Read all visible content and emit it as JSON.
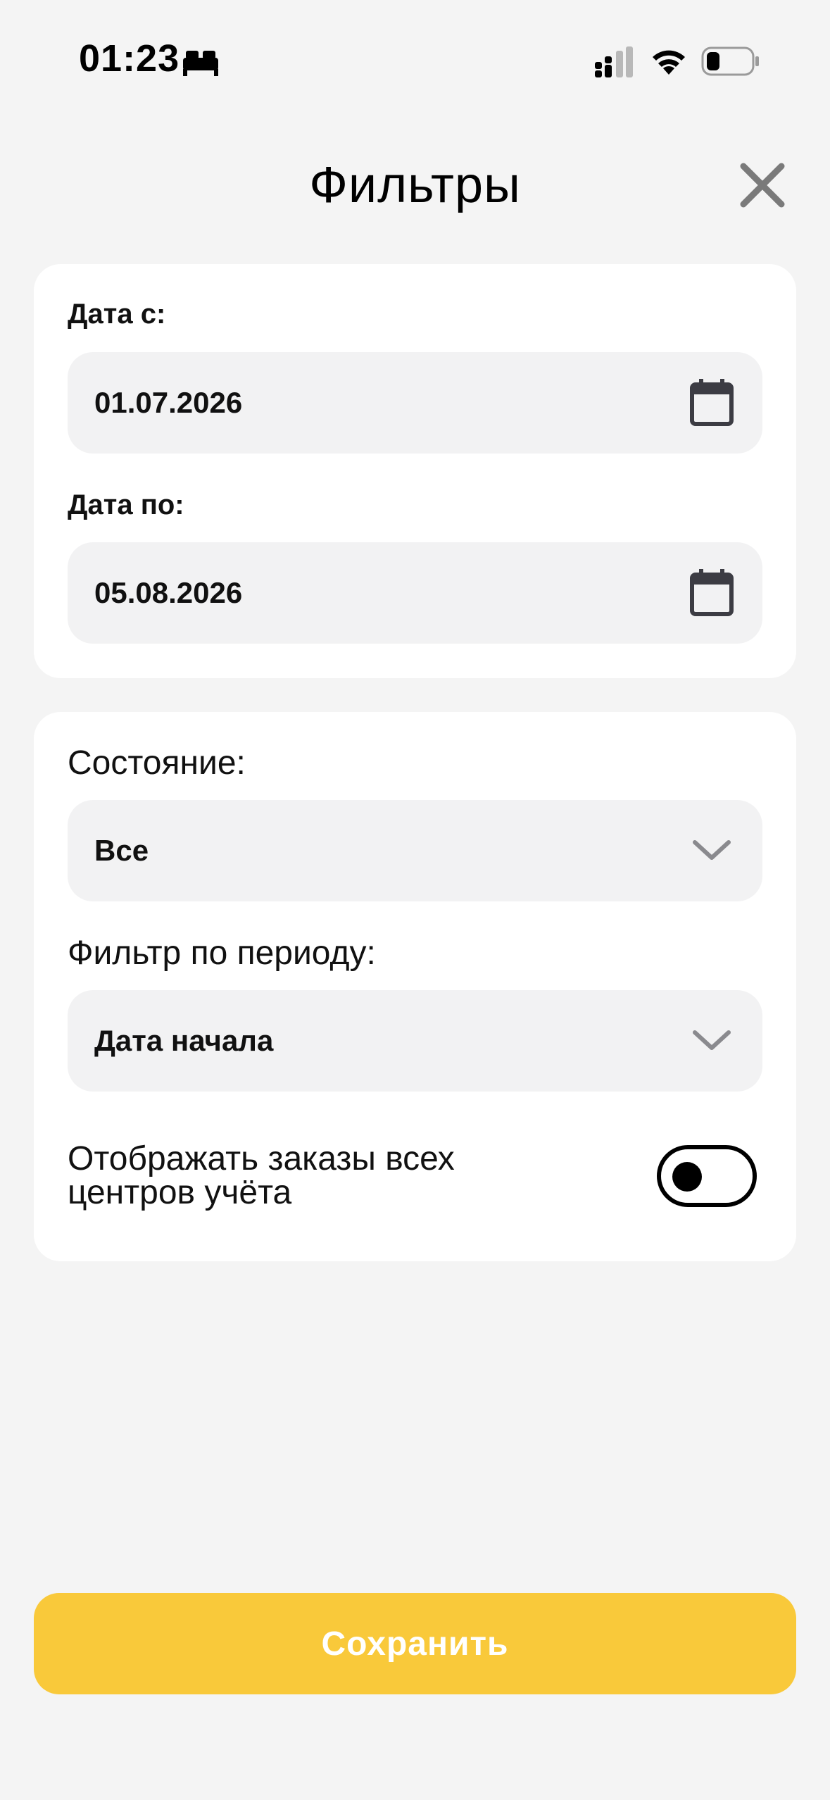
{
  "status_bar": {
    "time": "01:23"
  },
  "header": {
    "title": "Фильтры"
  },
  "date_section": {
    "date_from_label": "Дата с:",
    "date_from_value": "01.07.2026",
    "date_to_label": "Дата по:",
    "date_to_value": "05.08.2026"
  },
  "options_section": {
    "state_label": "Состояние:",
    "state_value": "Все",
    "period_label": "Фильтр по периоду:",
    "period_value": "Дата начала",
    "toggle_label_line1": "Отображать заказы всех",
    "toggle_label_line2": "центров учёта"
  },
  "footer": {
    "save_label": "Сохранить"
  },
  "colors": {
    "background": "#f4f4f4",
    "card": "#ffffff",
    "field": "#f2f2f3",
    "accent": "#f9c93a"
  }
}
